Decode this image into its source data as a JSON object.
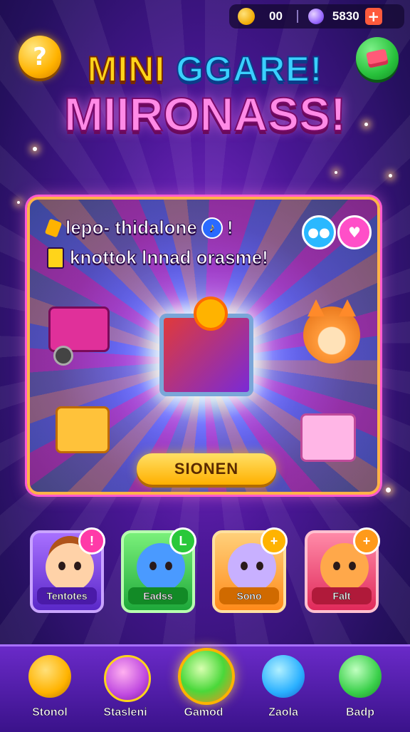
{
  "topbar": {
    "coins": "00",
    "gems": "5830",
    "add_label": "+"
  },
  "header": {
    "help_label": "?",
    "title_part1": "MINI",
    "title_part2": "GGARE!",
    "title_line2": "MIIRONASS!"
  },
  "panel": {
    "line1": "lepo- thidalone",
    "line1_suffix": "!",
    "line2": "knottok lnnad orasme!",
    "cta_label": "SIONEN"
  },
  "characters": [
    {
      "label": "Tentotes",
      "badge": "!"
    },
    {
      "label": "Eadss",
      "badge": "L"
    },
    {
      "label": "Sono",
      "badge": "+"
    },
    {
      "label": "Falt",
      "badge": "+"
    }
  ],
  "nav": {
    "items": [
      {
        "label": "Stonol"
      },
      {
        "label": "Stasleni"
      },
      {
        "label": "Gamod"
      },
      {
        "label": "Zaola"
      },
      {
        "label": "Badp"
      }
    ]
  },
  "icons": {
    "help": "question-icon",
    "shop": "shop-box-icon",
    "coin": "coin-icon",
    "gem": "gem-icon",
    "music_note": "music-note-icon",
    "chat": "chat-icon",
    "heart": "heart-icon"
  },
  "colors": {
    "background": "#4a1796",
    "panel_border": "#ffb347",
    "cta": "#ffc21a",
    "title_yellow": "#ffd41a",
    "title_blue": "#3ad0ff",
    "title_pink": "#ff8ae6"
  }
}
